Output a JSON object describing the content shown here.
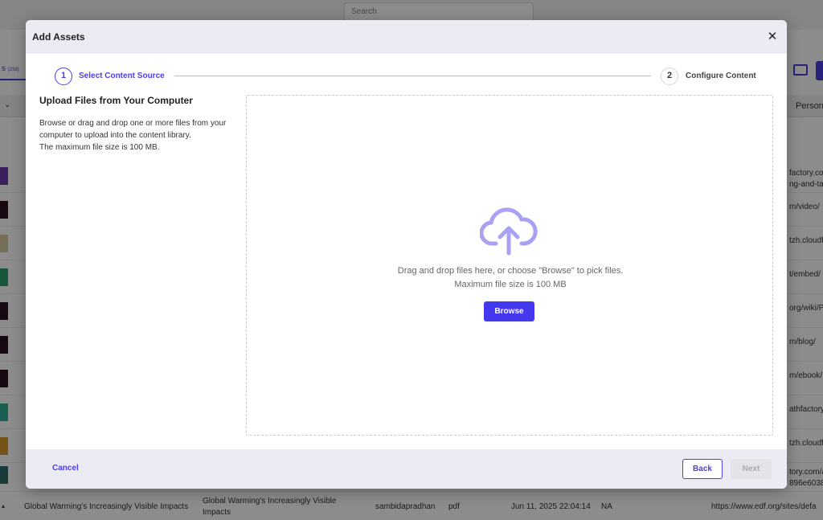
{
  "background": {
    "search_placeholder": "Search",
    "tab_label": "s",
    "tab_count": "(238)",
    "column_person": "Person",
    "row_urls": [
      "factory.co",
      "m/video/",
      "tzh.cloudf",
      "t/embed/",
      "org/wiki/P",
      "m/blog/",
      "m/ebook/",
      "athfactory.",
      "tzh.cloudf",
      "tory.com/a"
    ],
    "row_url_line2": [
      "ng-and-ta",
      "896e6038"
    ],
    "last_row": {
      "title": "Global Warming's Increasingly Visible Impacts",
      "title2_line1": "Global Warming's Increasingly Visible",
      "title2_line2": "Impacts",
      "owner": "sambidapradhan",
      "type": "pdf",
      "date": "Jun 11, 2025 22:04:14",
      "status": "NA",
      "url": "https://www.edf.org/sites/defa"
    }
  },
  "modal": {
    "title": "Add Assets",
    "close_glyph": "✕",
    "steps": [
      {
        "number": "1",
        "label": "Select Content Source"
      },
      {
        "number": "2",
        "label": "Configure Content"
      }
    ],
    "left": {
      "title": "Upload Files from Your Computer",
      "desc_line1": "Browse or drag and drop one or more files from your",
      "desc_line2": "computer to upload into the content library.",
      "desc_line3": "The maximum file size is 100 MB."
    },
    "dropzone": {
      "icon": "cloud-upload-icon",
      "line1": "Drag and drop files here, or choose \"Browse\" to pick files.",
      "line2": "Maximum file size is 100 MB",
      "browse_label": "Browse"
    },
    "footer": {
      "cancel_label": "Cancel",
      "back_label": "Back",
      "next_label": "Next"
    },
    "colors": {
      "accent": "#4338ee",
      "icon": "#a9a2f3"
    }
  }
}
